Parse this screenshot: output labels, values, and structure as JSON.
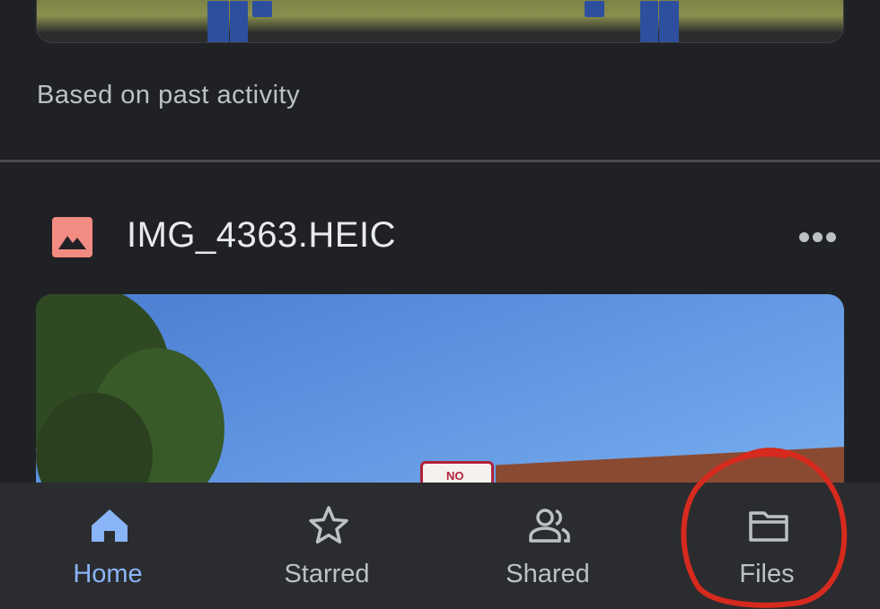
{
  "suggestion": {
    "reason": "Based on past activity"
  },
  "file": {
    "name": "IMG_4363.HEIC",
    "icon": "image-file-icon",
    "more_icon": "more-horizontal-icon"
  },
  "preview": {
    "sign_text": "NO"
  },
  "nav": {
    "items": [
      {
        "label": "Home",
        "icon": "home-icon",
        "active": true
      },
      {
        "label": "Starred",
        "icon": "star-icon",
        "active": false
      },
      {
        "label": "Shared",
        "icon": "people-icon",
        "active": false
      },
      {
        "label": "Files",
        "icon": "folder-icon",
        "active": false
      }
    ],
    "active_color": "#8ab4f8",
    "inactive_color": "#bdc1c6"
  },
  "colors": {
    "background": "#202124",
    "annotation": "#d62a1e",
    "file_icon": "#f28b82"
  }
}
